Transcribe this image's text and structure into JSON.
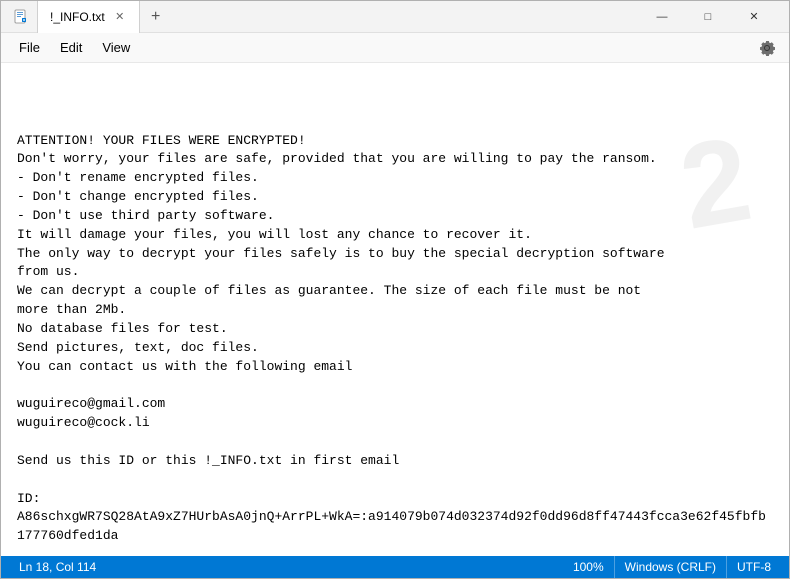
{
  "titlebar": {
    "icon": "notepad",
    "title": "!_INFO.txt",
    "tab_label": "!_INFO.txt",
    "add_tab_label": "+",
    "minimize": "—",
    "maximize": "□",
    "close": "✕"
  },
  "menubar": {
    "file": "File",
    "edit": "Edit",
    "view": "View",
    "gear_aria": "Settings"
  },
  "content": {
    "text": "ATTENTION! YOUR FILES WERE ENCRYPTED!\nDon't worry, your files are safe, provided that you are willing to pay the ransom.\n- Don't rename encrypted files.\n- Don't change encrypted files.\n- Don't use third party software.\nIt will damage your files, you will lost any chance to recover it.\nThe only way to decrypt your files safely is to buy the special decryption software\nfrom us.\nWe can decrypt a couple of files as guarantee. The size of each file must be not\nmore than 2Mb.\nNo database files for test.\nSend pictures, text, doc files.\nYou can contact us with the following email\n\nwuguireco@gmail.com\nwuguireco@cock.li\n\nSend us this ID or this !_INFO.txt in first email\n\nID:\nA86schxgWR7SQ28AtA9xZ7HUrbAsA0jnQ+ArrPL+WkA=:a914079b074d032374d92f0dd96d8ff47443fcca3e62f45fbfb177760dfed1da"
  },
  "statusbar": {
    "ln": "Ln 18, Col 114",
    "zoom": "100%",
    "line_ending": "Windows (CRLF)",
    "encoding": "UTF-8"
  },
  "watermark": {
    "text": "2"
  }
}
